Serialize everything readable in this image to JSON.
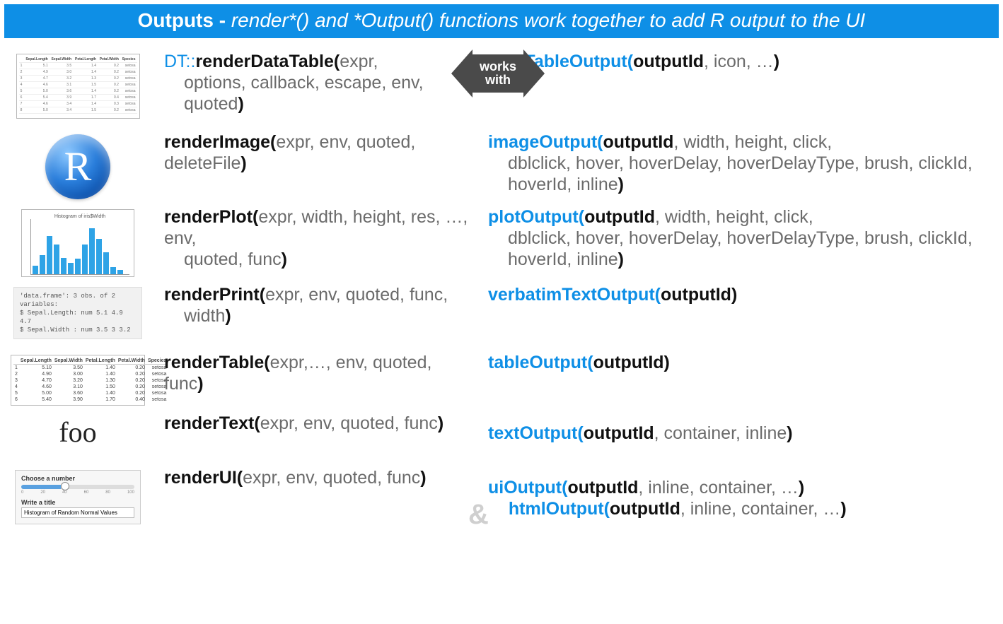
{
  "header": {
    "title_bold": "Outputs - ",
    "title_rest": "render*()  and *Output() functions work together to add R output to the UI"
  },
  "arrow": {
    "line1": "works",
    "line2": "with"
  },
  "rows": [
    {
      "render": {
        "prefix_ns": "DT::",
        "name": "renderDataTable(",
        "args_first": "expr",
        "args_rest": ", options, callback,  escape, env, quoted",
        "close": ")"
      },
      "output": {
        "name": "dataTableOutput(",
        "args_first": "outputId",
        "args_rest": ", icon, …",
        "close": ")"
      }
    },
    {
      "render": {
        "name": "renderImage(",
        "args_first": "expr",
        "args_rest": ", env, quoted, deleteFile",
        "close": ")"
      },
      "output": {
        "name": "imageOutput(",
        "args_first": "outputId",
        "args_rest": ", width, height, click, dblclick, hover, hoverDelay, hoverDelayType, brush, clickId, hoverId, inline",
        "close": ")"
      }
    },
    {
      "render": {
        "name": "renderPlot(",
        "args_first": "expr",
        "args_rest": ", width, height, res, …, env, quoted, func",
        "close": ")"
      },
      "output": {
        "name": "plotOutput(",
        "args_first": "outputId",
        "args_rest": ", width, height, click, dblclick, hover, hoverDelay, hoverDelayType, brush, clickId, hoverId, inline",
        "close": ")"
      }
    },
    {
      "render": {
        "name": "renderPrint(",
        "args_first": "expr",
        "args_rest": ", env, quoted, func, width",
        "close": ")"
      },
      "output": {
        "name": "verbatimTextOutput(",
        "args_first": "outputId",
        "args_rest": "",
        "close": ")"
      }
    },
    {
      "render": {
        "name": "renderTable(",
        "args_first": "expr",
        "args_rest": ",…, env, quoted, func",
        "close": ")"
      },
      "output": {
        "name": "tableOutput(",
        "args_first": "outputId",
        "args_rest": "",
        "close": ")"
      }
    },
    {
      "render": {
        "name": "renderText(",
        "args_first": "expr",
        "args_rest": ", env, quoted, func",
        "close": ")"
      },
      "output": {
        "name": "textOutput(",
        "args_first": "outputId",
        "args_rest": ", container, inline",
        "close": ")"
      }
    },
    {
      "render": {
        "name": "renderUI(",
        "args_first": "expr",
        "args_rest": ", env, quoted, func",
        "close": ")"
      },
      "output": {
        "name": "uiOutput(",
        "args_first": "outputId",
        "args_rest": ", inline, container, …",
        "close": ")"
      },
      "output2": {
        "amp": "&",
        "name": "htmlOutput(",
        "args_first": "outputId",
        "args_rest": ", inline, container, …",
        "close": ")"
      }
    }
  ],
  "thumbs": {
    "r_letter": "R",
    "foo": "foo",
    "print_l1": "'data.frame':   3 obs. of  2 variables:",
    "print_l2": " $ Sepal.Length: num  5.1 4.9 4.7",
    "print_l3": " $ Sepal.Width : num  3.5 3 3.2",
    "plot_title": "Histogram of iris$Width",
    "table2_headers": [
      "",
      "Sepal.Length",
      "Sepal.Width",
      "Petal.Length",
      "Petal.Width",
      "Species"
    ],
    "table2_rows": [
      [
        "1",
        "5.10",
        "3.50",
        "1.40",
        "0.20",
        "setosa"
      ],
      [
        "2",
        "4.90",
        "3.00",
        "1.40",
        "0.20",
        "setosa"
      ],
      [
        "3",
        "4.70",
        "3.20",
        "1.30",
        "0.20",
        "setosa"
      ],
      [
        "4",
        "4.60",
        "3.10",
        "1.50",
        "0.20",
        "setosa"
      ],
      [
        "5",
        "5.00",
        "3.60",
        "1.40",
        "0.20",
        "setosa"
      ],
      [
        "6",
        "5.40",
        "3.90",
        "1.70",
        "0.40",
        "setosa"
      ]
    ],
    "ui_slider_label": "Choose a number",
    "ui_slider_min": "0",
    "ui_slider_max": "100",
    "ui_text_label": "Write a title",
    "ui_text_value": "Histogram of Random Normal Values"
  }
}
